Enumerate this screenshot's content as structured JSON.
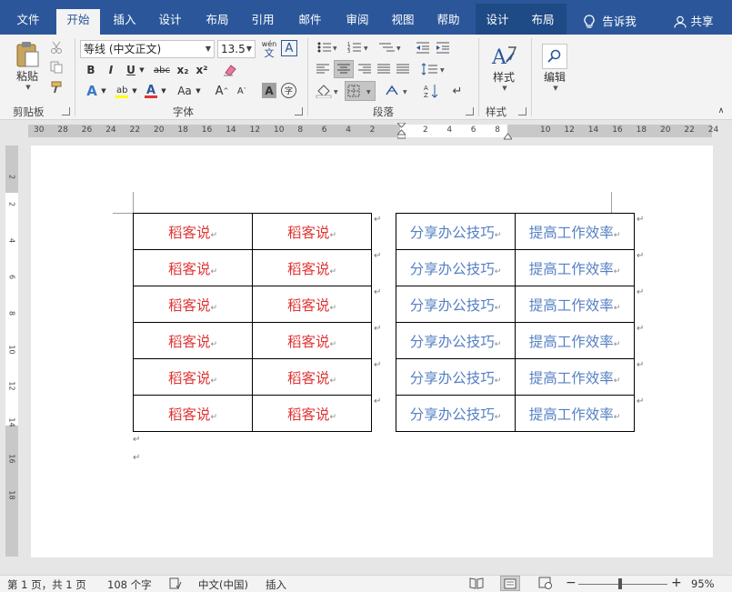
{
  "tabs": [
    "文件",
    "开始",
    "插入",
    "设计",
    "布局",
    "引用",
    "邮件",
    "审阅",
    "视图",
    "帮助",
    "设计",
    "布局"
  ],
  "tell_me": "告诉我",
  "share": "共享",
  "ribbon": {
    "paste": "粘贴",
    "clipboard": "剪贴板",
    "font_name": "等线 (中文正文)",
    "font_size": "13.5",
    "font_group": "字体",
    "wen_top": "wén",
    "wen_bottom": "文",
    "para_group": "段落",
    "styles": "样式",
    "styles_group": "样式",
    "edit": "编辑",
    "bold": "B",
    "italic": "I",
    "underline": "U",
    "strike": "abc",
    "sub": "x₂",
    "sup": "x²",
    "grow": "A",
    "shrink": "A",
    "case": "Aa",
    "boxA": "A",
    "circle": "字"
  },
  "ruler": {
    "left_nums": [
      "30",
      "28",
      "26",
      "24",
      "22",
      "20",
      "18",
      "16",
      "14",
      "12",
      "10",
      "8",
      "6",
      "4",
      "2"
    ],
    "mid_nums": [
      "2",
      "4",
      "6",
      "8"
    ],
    "right_nums": [
      "10",
      "12",
      "14",
      "16",
      "18",
      "20",
      "22",
      "24"
    ],
    "v_nums": [
      "2",
      "2",
      "4",
      "6",
      "8",
      "10",
      "12",
      "14",
      "16",
      "18"
    ],
    "tab_marker": "L"
  },
  "table_left": {
    "rows": [
      [
        "稻客说",
        "稻客说"
      ],
      [
        "稻客说",
        "稻客说"
      ],
      [
        "稻客说",
        "稻客说"
      ],
      [
        "稻客说",
        "稻客说"
      ],
      [
        "稻客说",
        "稻客说"
      ],
      [
        "稻客说",
        "稻客说"
      ]
    ]
  },
  "table_right": {
    "rows": [
      [
        "分享办公技巧",
        "提高工作效率"
      ],
      [
        "分享办公技巧",
        "提高工作效率"
      ],
      [
        "分享办公技巧",
        "提高工作效率"
      ],
      [
        "分享办公技巧",
        "提高工作效率"
      ],
      [
        "分享办公技巧",
        "提高工作效率"
      ],
      [
        "分享办公技巧",
        "提高工作效率"
      ]
    ]
  },
  "para_mark": "↵",
  "status": {
    "page": "第 1 页，共 1 页",
    "words": "108 个字",
    "lang": "中文(中国)",
    "mode": "插入",
    "zoom": "95%"
  },
  "colors": {
    "accent": "#2b579a",
    "red_text": "#e03434",
    "blue_text": "#5580c4"
  }
}
